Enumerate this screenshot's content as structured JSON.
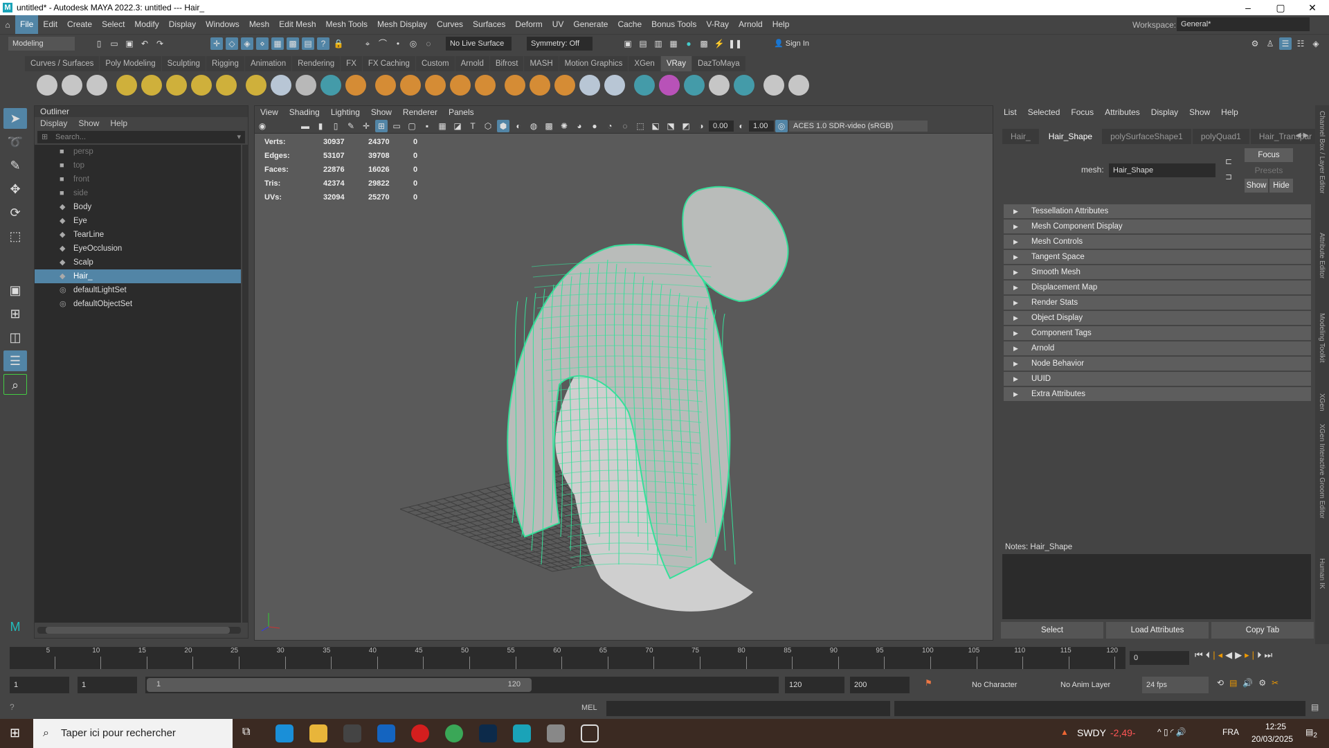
{
  "window": {
    "title": "untitled* - Autodesk MAYA 2022.3: untitled  ---  Hair_",
    "min": "–",
    "max": "▢",
    "close": "✕"
  },
  "menu": [
    "File",
    "Edit",
    "Create",
    "Select",
    "Modify",
    "Display",
    "Windows",
    "Mesh",
    "Edit Mesh",
    "Mesh Tools",
    "Mesh Display",
    "Curves",
    "Surfaces",
    "Deform",
    "UV",
    "Generate",
    "Cache",
    "Bonus Tools",
    "V-Ray",
    "Arnold",
    "Help"
  ],
  "workspace": {
    "label": "Workspace:",
    "value": "General*"
  },
  "statusline": {
    "mode": "Modeling",
    "live_surface": "No Live Surface",
    "symmetry": "Symmetry: Off",
    "sign_in": "Sign In"
  },
  "shelf_tabs": [
    "Curves / Surfaces",
    "Poly Modeling",
    "Sculpting",
    "Rigging",
    "Animation",
    "Rendering",
    "FX",
    "FX Caching",
    "Custom",
    "Arnold",
    "Bifrost",
    "MASH",
    "Motion Graphics",
    "XGen",
    "VRay",
    "DazToMaya"
  ],
  "shelf_active": "VRay",
  "outliner": {
    "title": "Outliner",
    "menu": [
      "Display",
      "Show",
      "Help"
    ],
    "search_placeholder": "Search...",
    "items": [
      {
        "label": "persp",
        "icon": "camera-icon",
        "dim": true
      },
      {
        "label": "top",
        "icon": "camera-icon",
        "dim": true
      },
      {
        "label": "front",
        "icon": "camera-icon",
        "dim": true
      },
      {
        "label": "side",
        "icon": "camera-icon",
        "dim": true
      },
      {
        "label": "Body",
        "icon": "mesh-icon"
      },
      {
        "label": "Eye",
        "icon": "mesh-icon"
      },
      {
        "label": "TearLine",
        "icon": "mesh-icon"
      },
      {
        "label": "EyeOcclusion",
        "icon": "mesh-icon"
      },
      {
        "label": "Scalp",
        "icon": "mesh-icon"
      },
      {
        "label": "Hair_",
        "icon": "mesh-icon",
        "selected": true
      },
      {
        "label": "defaultLightSet",
        "icon": "set-icon"
      },
      {
        "label": "defaultObjectSet",
        "icon": "set-icon"
      }
    ]
  },
  "viewport": {
    "menu": [
      "View",
      "Shading",
      "Lighting",
      "Show",
      "Renderer",
      "Panels"
    ],
    "exposure": "0.00",
    "gamma": "1.00",
    "color_space": "ACES 1.0 SDR-video (sRGB)",
    "hud": [
      [
        "Verts:",
        "30937",
        "24370",
        "0"
      ],
      [
        "Edges:",
        "53107",
        "39708",
        "0"
      ],
      [
        "Faces:",
        "22876",
        "16026",
        "0"
      ],
      [
        "Tris:",
        "42374",
        "29822",
        "0"
      ],
      [
        "UVs:",
        "32094",
        "25270",
        "0"
      ]
    ]
  },
  "attribute_editor": {
    "menu": [
      "List",
      "Selected",
      "Focus",
      "Attributes",
      "Display",
      "Show",
      "Help"
    ],
    "tabs": [
      "Hair_",
      "Hair_Shape",
      "polySurfaceShape1",
      "polyQuad1",
      "Hair_Transpar"
    ],
    "active_tab": "Hair_Shape",
    "mesh_label": "mesh:",
    "mesh_value": "Hair_Shape",
    "focus": "Focus",
    "presets": "Presets",
    "show": "Show",
    "hide": "Hide",
    "sections": [
      "Tessellation Attributes",
      "Mesh Component Display",
      "Mesh Controls",
      "Tangent Space",
      "Smooth Mesh",
      "Displacement Map",
      "Render Stats",
      "Object Display",
      "Component Tags",
      "Arnold",
      "Node Behavior",
      "UUID",
      "Extra Attributes"
    ],
    "notes_label": "Notes:  Hair_Shape",
    "buttons": [
      "Select",
      "Load Attributes",
      "Copy Tab"
    ]
  },
  "side_tabs": [
    "Channel Box / Layer Editor",
    "Attribute Editor",
    "Modeling Toolkit",
    "XGen",
    "XGen Interactive Groom Editor",
    "Human IK"
  ],
  "timeline": {
    "ticks": [
      "5",
      "10",
      "15",
      "20",
      "25",
      "30",
      "35",
      "40",
      "45",
      "50",
      "55",
      "60",
      "65",
      "70",
      "75",
      "80",
      "85",
      "90",
      "95",
      "100",
      "105",
      "110",
      "115",
      "120"
    ],
    "current": "0"
  },
  "range": {
    "start": "1",
    "anim_start": "1",
    "slider_start": "1",
    "slider_end": "120",
    "end": "120",
    "anim_end": "200",
    "character_set": "No Character Set",
    "anim_layer": "No Anim Layer",
    "fps": "24 fps"
  },
  "cmd": {
    "lang": "MEL"
  },
  "taskbar": {
    "search": "Taper ici pour rechercher",
    "ticker": "SWDY",
    "ticker_change": "-2,49-",
    "lang": "FRA",
    "time": "12:25",
    "date": "20/03/2025",
    "notif": "2"
  }
}
